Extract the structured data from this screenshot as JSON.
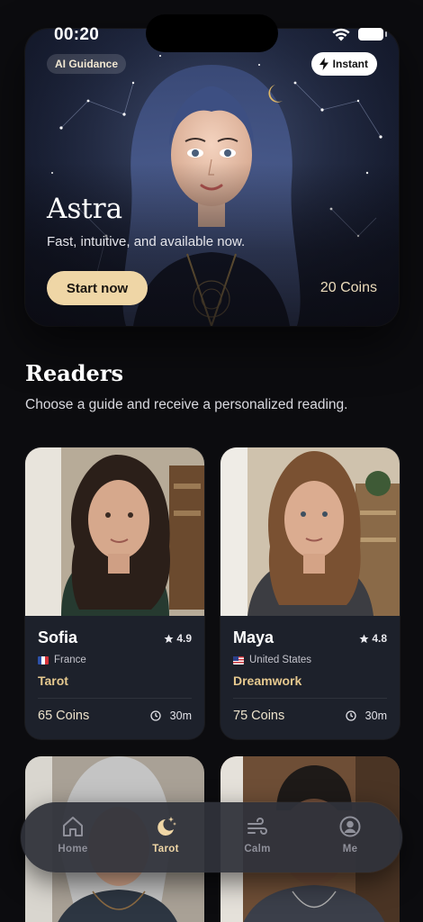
{
  "status": {
    "time": "00:20"
  },
  "hero": {
    "badge_ai": "AI Guidance",
    "badge_instant": "Instant",
    "name": "Astra",
    "tagline": "Fast, intuitive, and available now.",
    "cta_label": "Start now",
    "coins": "20 Coins"
  },
  "section": {
    "title": "Readers",
    "subtitle": "Choose a guide and receive a personalized reading."
  },
  "readers": [
    {
      "name": "Sofia",
      "rating": "4.9",
      "country": "France",
      "skill": "Tarot",
      "coins": "65 Coins",
      "duration": "30m"
    },
    {
      "name": "Maya",
      "rating": "4.8",
      "country": "United States",
      "skill": "Dreamwork",
      "coins": "75 Coins",
      "duration": "30m"
    }
  ],
  "tabs": [
    {
      "label": "Home",
      "icon": "home-icon",
      "active": false
    },
    {
      "label": "Tarot",
      "icon": "moon-stars-icon",
      "active": true
    },
    {
      "label": "Calm",
      "icon": "wind-icon",
      "active": false
    },
    {
      "label": "Me",
      "icon": "profile-icon",
      "active": false
    }
  ],
  "colors": {
    "accent": "#efd6a6",
    "skill": "#e6c98f",
    "card": "#1d212b",
    "background": "#0c0c0f"
  }
}
